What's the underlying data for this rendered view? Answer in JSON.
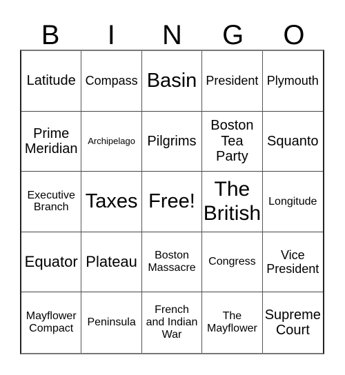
{
  "header": {
    "letters": [
      "B",
      "I",
      "N",
      "G",
      "O"
    ]
  },
  "board": {
    "rows": [
      [
        "Latitude",
        "Compass",
        "Basin",
        "President",
        "Plymouth"
      ],
      [
        "Prime\nMeridian",
        "Archipelago",
        "Pilgrims",
        "Boston\nTea\nParty",
        "Squanto"
      ],
      [
        "Executive\nBranch",
        "Taxes",
        "Free!",
        "The\nBritish",
        "Longitude"
      ],
      [
        "Equator",
        "Plateau",
        "Boston\nMassacre",
        "Congress",
        "Vice\nPresident"
      ],
      [
        "Mayflower\nCompact",
        "Peninsula",
        "French\nand Indian\nWar",
        "The\nMayflower",
        "Supreme\nCourt"
      ]
    ],
    "free_space": "Free!"
  }
}
